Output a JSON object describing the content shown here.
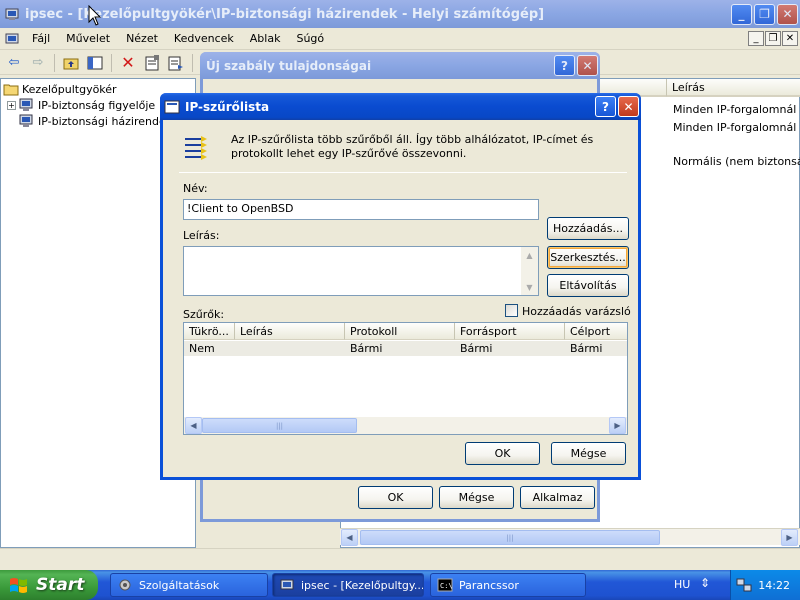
{
  "main_window": {
    "title": "ipsec - [Kezelőpultgyökér\\IP-biztonsági házirendek - Helyi számítógép]",
    "menu": [
      {
        "label": "Fájl"
      },
      {
        "label": "Művelet"
      },
      {
        "label": "Nézet"
      },
      {
        "label": "Kedvencek"
      },
      {
        "label": "Ablak"
      },
      {
        "label": "Súgó"
      }
    ],
    "tree": {
      "root": "Kezelőpultgyökér",
      "items": [
        "IP-biztonság figyelője",
        "IP-biztonsági házirendek"
      ]
    },
    "list": {
      "column_leiras": "Leírás",
      "rows": [
        "Minden IP-forgalomnál min",
        "Minden IP-forgalomnál min",
        "Normális (nem biztonságos"
      ]
    }
  },
  "rule_dialog": {
    "title": "Új szabály tulajdonságai",
    "buttons": {
      "ok": "OK",
      "cancel": "Mégse",
      "apply": "Alkalmaz"
    }
  },
  "filter_dialog": {
    "title": "IP-szűrőlista",
    "description": "Az IP-szűrőlista több szűrőből áll. Így több alhálózatot, IP-címet és protokollt lehet egy IP-szűrővé összevonni.",
    "name_label": "Név:",
    "name_value": "!Client to OpenBSD",
    "desc_label": "Leírás:",
    "desc_value": "",
    "buttons": {
      "add": "Hozzáadás...",
      "edit": "Szerkesztés...",
      "remove": "Eltávolítás",
      "ok": "OK",
      "cancel": "Mégse"
    },
    "filters_label": "Szűrők:",
    "wizard_label": "Hozzáadás varázsló",
    "wizard_checked": false,
    "columns": [
      "Tükrö...",
      "Leírás",
      "Protokoll",
      "Forrásport",
      "Célport"
    ],
    "rows": [
      [
        "Nem",
        "",
        "Bármi",
        "Bármi",
        "Bármi"
      ]
    ]
  },
  "taskbar": {
    "start_label": "Start",
    "tasks": [
      {
        "label": "Szolgáltatások"
      },
      {
        "label": "ipsec - [Kezelőpultgy..."
      },
      {
        "label": "Parancssor"
      }
    ],
    "language": "HU",
    "clock": "14:22"
  },
  "colors": {
    "title_active": "#0a4bd0",
    "title_inactive": "#8aa6e3",
    "dialog_bg": "#ece9d8",
    "taskbar": "#2157d7",
    "start_green": "#3a9a3a"
  }
}
